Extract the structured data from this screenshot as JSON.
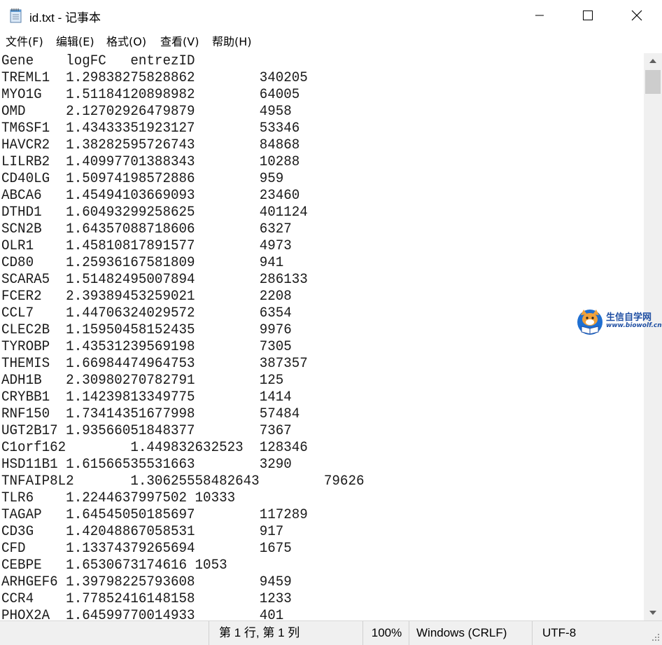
{
  "window": {
    "title": "id.txt - 记事本",
    "icons": {
      "app": "notepad-icon",
      "minimize": "minimize-icon",
      "maximize": "maximize-icon",
      "close": "close-icon"
    }
  },
  "menu": [
    "文件(F)",
    "编辑(E)",
    "格式(O)",
    "查看(V)",
    "帮助(H)"
  ],
  "lines": [
    "Gene    logFC   entrezID",
    "TREML1  1.29838275828862        340205",
    "MYO1G   1.51184120898982        64005",
    "OMD     2.12702926479879        4958",
    "TM6SF1  1.43433351923127        53346",
    "HAVCR2  1.38282595726743        84868",
    "LILRB2  1.40997701388343        10288",
    "CD40LG  1.50974198572886        959",
    "ABCA6   1.45494103669093        23460",
    "DTHD1   1.60493299258625        401124",
    "SCN2B   1.64357088718606        6327",
    "OLR1    1.45810817891577        4973",
    "CD80    1.25936167581809        941",
    "SCARA5  1.51482495007894        286133",
    "FCER2   2.39389453259021        2208",
    "CCL7    1.44706324029572        6354",
    "CLEC2B  1.15950458152435        9976",
    "TYROBP  1.43531239569198        7305",
    "THEMIS  1.66984474964753        387357",
    "ADH1B   2.30980270782791        125",
    "CRYBB1  1.14239813349775        1414",
    "RNF150  1.73414351677998        57484",
    "UGT2B17 1.93566051848377        7367",
    "C1orf162        1.449832632523  128346",
    "HSD11B1 1.61566535531663        3290",
    "TNFAIP8L2       1.30625558482643        79626",
    "TLR6    1.2244637997502 10333",
    "TAGAP   1.64545050185697        117289",
    "CD3G    1.42048867058531        917",
    "CFD     1.13374379265694        1675",
    "CEBPE   1.6530673174616 1053",
    "ARHGEF6 1.39798225793608        9459",
    "CCR4    1.77852416148158        1233",
    "PHOX2A  1.64599770014933        401"
  ],
  "scrollbar": {
    "up_icon": "scroll-up-arrow-icon",
    "down_icon": "scroll-down-arrow-icon"
  },
  "watermark": {
    "title": "生信自学网",
    "url": "www.biowolf.cn",
    "icon": "fox-reading-logo-icon"
  },
  "status": {
    "position": "第 1 行, 第 1 列",
    "zoom": "100%",
    "line_ending": "Windows (CRLF)",
    "encoding": "UTF-8"
  },
  "colors": {
    "accent": "#1f4fa3",
    "statusbar_bg": "#f0f0f0",
    "scroll_thumb": "#cdcdcd"
  }
}
